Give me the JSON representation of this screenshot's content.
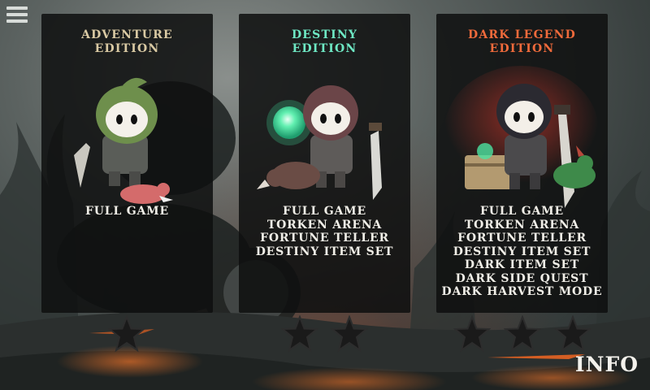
{
  "menu": {
    "icon": "hamburger-menu-icon"
  },
  "editions": [
    {
      "title_line1": "ADVENTURE",
      "title_line2": "EDITION",
      "title_color": "#d9c9a3",
      "features": [
        "FULL GAME"
      ],
      "stars": 1
    },
    {
      "title_line1": "DESTINY",
      "title_line2": "EDITION",
      "title_color": "#6ee8c4",
      "features": [
        "FULL GAME",
        "TORKEN ARENA",
        "FORTUNE TELLER",
        "DESTINY ITEM SET"
      ],
      "stars": 2
    },
    {
      "title_line1": "DARK LEGEND",
      "title_line2": "EDITION",
      "title_color": "#ef6a3b",
      "features": [
        "FULL GAME",
        "TORKEN ARENA",
        "FORTUNE TELLER",
        "DESTINY ITEM SET",
        "DARK ITEM SET",
        "DARK SIDE QUEST",
        "DARK HARVEST MODE"
      ],
      "stars": 3
    }
  ],
  "info_label": "INFO"
}
